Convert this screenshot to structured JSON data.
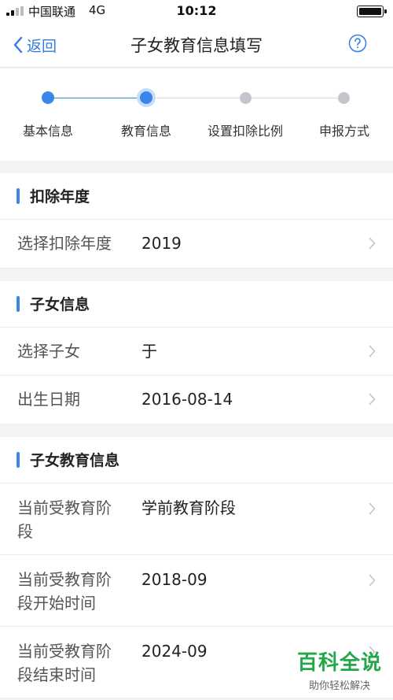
{
  "status_bar": {
    "carrier": "中国联通",
    "network": "4G",
    "time": "10:12"
  },
  "nav": {
    "back_label": "返回",
    "title": "子女教育信息填写",
    "help_icon": "question-circle-icon"
  },
  "stepper": {
    "steps": [
      {
        "label": "基本信息",
        "state": "done"
      },
      {
        "label": "教育信息",
        "state": "active"
      },
      {
        "label": "设置扣除比例",
        "state": "pending"
      },
      {
        "label": "申报方式",
        "state": "pending"
      }
    ]
  },
  "sections": [
    {
      "title": "扣除年度",
      "rows": [
        {
          "label": "选择扣除年度",
          "value": "2019"
        }
      ]
    },
    {
      "title": "子女信息",
      "rows": [
        {
          "label": "选择子女",
          "value": "于"
        },
        {
          "label": "出生日期",
          "value": "2016-08-14"
        }
      ]
    },
    {
      "title": "子女教育信息",
      "rows": [
        {
          "label_line1": "当前受教育阶",
          "label_line2": "段",
          "value": "学前教育阶段"
        },
        {
          "label_line1": "当前受教育阶",
          "label_line2": "段开始时间",
          "value": "2018-09"
        },
        {
          "label_line1": "当前受教育阶",
          "label_line2": "段结束时间",
          "value": "2024-09"
        }
      ]
    }
  ],
  "watermark": {
    "title": "百科全说",
    "subtitle": "助你轻松解决"
  },
  "colors": {
    "accent": "#3a85ea",
    "pending": "#c4c6cc",
    "watermark": "#23a74a"
  }
}
